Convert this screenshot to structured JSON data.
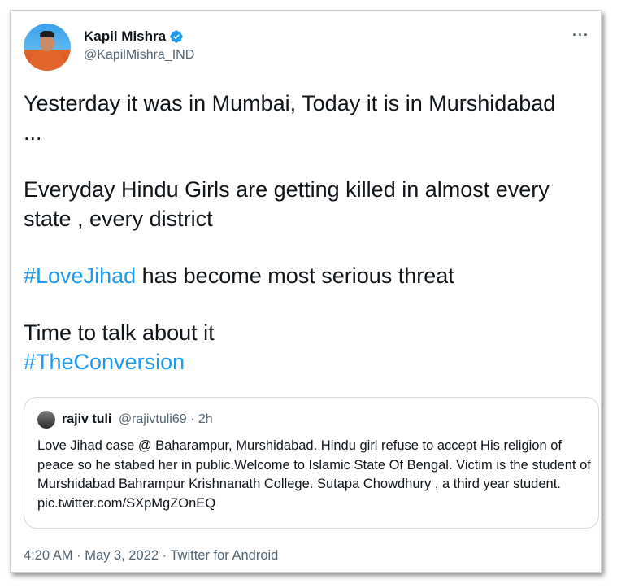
{
  "author": {
    "display_name": "Kapil Mishra",
    "handle": "@KapilMishra_IND"
  },
  "tweet": {
    "paragraphs": [
      {
        "text": "Yesterday it was in Mumbai, Today it is in Murshidabad\n..."
      },
      {
        "text": "Everyday Hindu Girls are getting killed in almost every\nstate , every district"
      },
      {
        "hashtag": "#LoveJihad",
        "text": " has become most serious threat"
      },
      {
        "text": "Time to talk about it",
        "hashtag_line": "#TheConversion"
      }
    ]
  },
  "quoted_tweet": {
    "name": "rajiv tuli",
    "handle_time": "@rajivtuli69 · 2h",
    "body": "Love Jihad case @ Baharampur, Murshidabad. Hindu girl refuse to accept His religion of peace so he stabed her in public.Welcome to Islamic State Of Bengal. Victim is the student of Murshidabad Bahrampur Krishnanath College.  Sutapa Chowdhury , a third year student. pic.twitter.com/SXpMgZOnEQ"
  },
  "timestamp": "4:20 AM · May 3, 2022 · Twitter for Android",
  "icons": {
    "verified": "verified-badge-icon",
    "more": "more-options-icon"
  },
  "colors": {
    "hashtag": "#1d9bf0",
    "verified": "#1d9bf0",
    "secondary_text": "#536471"
  }
}
